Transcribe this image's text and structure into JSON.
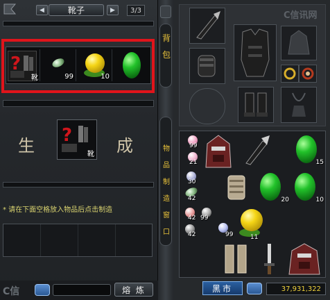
{
  "craft_panel": {
    "title": "靴子",
    "page_indicator": "3/3",
    "prev_arrow": "◀",
    "next_arrow": "▶",
    "material_slots": [
      {
        "item": "boots-recipe",
        "label": "靴",
        "qty": ""
      },
      {
        "item": "white-green-pill",
        "qty": "99"
      },
      {
        "item": "yellow-orb",
        "qty": "10"
      },
      {
        "item": "green-gem",
        "qty": ""
      }
    ],
    "left_char": "生",
    "right_char": "成",
    "result_label": "靴",
    "hint": "* 请在下面空格放入物品后点击制造",
    "smelt_button": "熔 炼",
    "logo_text": "C信"
  },
  "divider": {
    "bag_label": [
      "背",
      "包"
    ],
    "vertical_menu": [
      "物",
      "品",
      "制",
      "造",
      "窗",
      "口"
    ]
  },
  "equipment_panel": {
    "watermark": "C信讯网"
  },
  "inventory": {
    "cells": [
      {
        "item": "pink-orb",
        "qty": "99"
      },
      {
        "item": "pink-orb",
        "qty": "21"
      },
      {
        "item": "demon-helmet",
        "qty": ""
      },
      {
        "item": "claw-weapon",
        "qty": ""
      },
      {
        "item": "green-gem",
        "qty": "15"
      },
      {
        "item": "blue-orb",
        "qty": "30"
      },
      {
        "item": "white-green-pill",
        "qty": "42"
      },
      {
        "item": "bone-gauntlet",
        "qty": ""
      },
      {
        "item": "green-gem",
        "qty": "20"
      },
      {
        "item": "green-gem",
        "qty": "10"
      },
      {
        "item": "red-orb",
        "qty": "42"
      },
      {
        "item": "gray-orb",
        "qty": "99"
      },
      {
        "item": "gray-orb",
        "qty": "42"
      },
      {
        "item": "blue-orb",
        "qty": "99"
      },
      {
        "item": "yellow-orb",
        "qty": "11"
      },
      {
        "item": "leg-armor",
        "qty": ""
      },
      {
        "item": "dagger",
        "qty": ""
      },
      {
        "item": "demon-helmet",
        "qty": ""
      }
    ]
  },
  "footer": {
    "black_market": "黑市",
    "money": "37,931,322"
  },
  "colors": {
    "highlight_border": "#e0141b",
    "gold_text": "#e8c23a",
    "hint_text": "#d9d36f",
    "market_blue": "#2a5fa0"
  }
}
